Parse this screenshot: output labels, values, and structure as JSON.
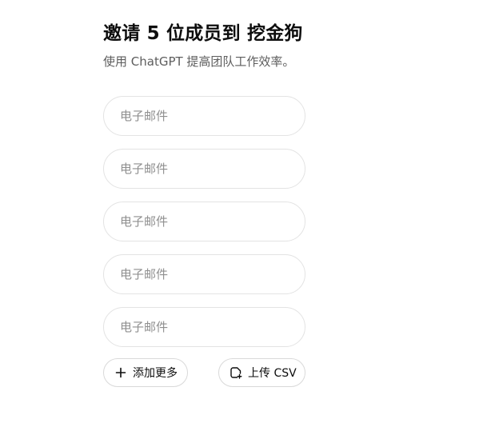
{
  "header": {
    "title": "邀请 5 位成员到 挖金狗",
    "subtitle": "使用 ChatGPT 提高团队工作效率。"
  },
  "email_fields": [
    {
      "placeholder": "电子邮件",
      "value": ""
    },
    {
      "placeholder": "电子邮件",
      "value": ""
    },
    {
      "placeholder": "电子邮件",
      "value": ""
    },
    {
      "placeholder": "电子邮件",
      "value": ""
    },
    {
      "placeholder": "电子邮件",
      "value": ""
    }
  ],
  "actions": {
    "add_more_label": "添加更多",
    "add_more_icon": "plus-icon",
    "upload_csv_label": "上传 CSV",
    "upload_csv_icon": "file-upload-icon"
  }
}
